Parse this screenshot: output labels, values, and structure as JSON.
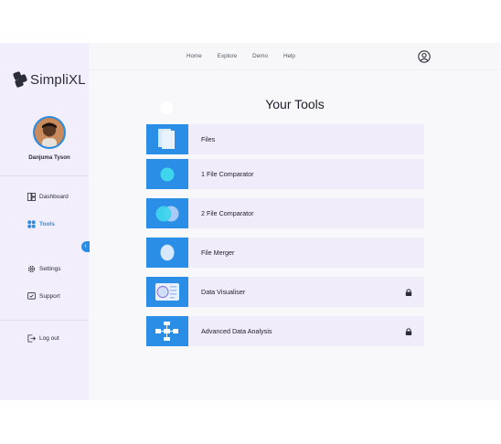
{
  "brand": {
    "name": "SimpliXL"
  },
  "user": {
    "name": "Danjuma Tyson"
  },
  "topnav": {
    "links": [
      "Home",
      "Explore",
      "Demo",
      "Help"
    ]
  },
  "sidebar": {
    "items": [
      {
        "label": "Dashboard",
        "icon": "dashboard-icon"
      },
      {
        "label": "Tools",
        "icon": "tools-icon",
        "active": true
      },
      {
        "label": "Settings",
        "icon": "settings-icon"
      },
      {
        "label": "Support",
        "icon": "support-icon"
      },
      {
        "label": "Log out",
        "icon": "logout-icon"
      }
    ]
  },
  "main": {
    "title": "Your Tools",
    "tools": [
      {
        "label": "Files",
        "icon": "files-icon",
        "locked": false
      },
      {
        "label": "1 File Comparator",
        "icon": "single-circle-icon",
        "locked": false
      },
      {
        "label": "2 File Comparator",
        "icon": "double-circle-icon",
        "locked": false
      },
      {
        "label": "File Merger",
        "icon": "merge-icon",
        "locked": false
      },
      {
        "label": "Data Visualiser",
        "icon": "data-visualiser-icon",
        "locked": true
      },
      {
        "label": "Advanced Data Analysis",
        "icon": "flow-diagram-icon",
        "locked": true
      }
    ]
  },
  "colors": {
    "accent": "#2a8ee6",
    "sidebar_bg": "#f3eefb",
    "row_bg": "#f1ecfa"
  }
}
